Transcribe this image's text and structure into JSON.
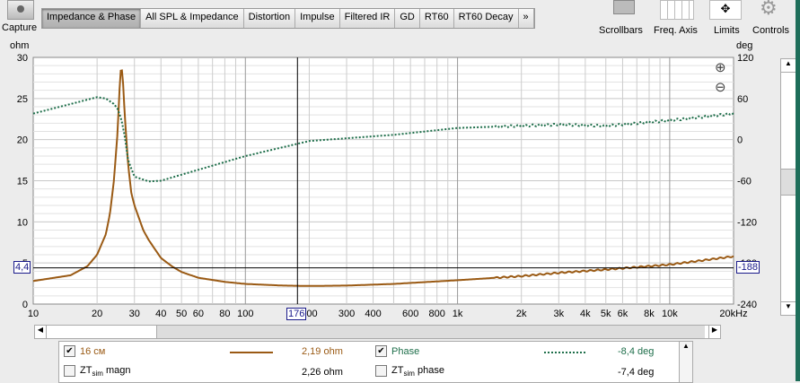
{
  "toolbar": {
    "capture": "Capture",
    "tabs": [
      "Impedance & Phase",
      "All SPL & Impedance",
      "Distortion",
      "Impulse",
      "Filtered IR",
      "GD",
      "RT60",
      "RT60 Decay",
      "»"
    ],
    "tools": [
      "Scrollbars",
      "Freq. Axis",
      "Limits",
      "Controls"
    ]
  },
  "cursor": {
    "freq": "176",
    "left_value": "4,4",
    "right_value": "-188"
  },
  "legend": {
    "rows": [
      {
        "name": "16 см",
        "checked": true,
        "value": "2,19 ohm",
        "phase_name": "Phase",
        "phase_checked": true,
        "phase_value": "-8,4 deg"
      },
      {
        "name": "ZT",
        "sub": "sim",
        "suffix": " magn",
        "checked": false,
        "value": "2,26 ohm",
        "phase_name": "ZT",
        "phase_sub": "sim",
        "phase_suffix": " phase",
        "phase_checked": false,
        "phase_value": "-7,4 deg"
      }
    ]
  },
  "chart_data": {
    "type": "line",
    "xscale": "log",
    "xlim": [
      10,
      20000
    ],
    "ylim": [
      0,
      30
    ],
    "y2lim": [
      -240,
      120
    ],
    "ylabel": "ohm",
    "y2label": "deg",
    "xunit": "kHz",
    "xticks": [
      "10",
      "20",
      "30",
      "40",
      "50",
      "60",
      "80",
      "100",
      "200",
      "300",
      "400",
      "600",
      "800",
      "1k",
      "2k",
      "3k",
      "4k",
      "5k",
      "6k",
      "8k",
      "10k",
      "20kHz"
    ],
    "xtick_values": [
      10,
      20,
      30,
      40,
      50,
      60,
      80,
      100,
      200,
      300,
      400,
      600,
      800,
      1000,
      2000,
      3000,
      4000,
      5000,
      6000,
      8000,
      10000,
      20000
    ],
    "yticks": [
      0,
      5,
      10,
      15,
      20,
      25,
      30
    ],
    "y2ticks": [
      -240,
      -180,
      -120,
      -60,
      0,
      60,
      120
    ],
    "grid": true,
    "series": [
      {
        "name": "16 см",
        "axis": "left",
        "color": "#9a5a14",
        "style": "solid",
        "x": [
          10,
          15,
          18,
          20,
          22,
          23,
          24,
          25,
          25.5,
          26,
          26.5,
          27,
          28,
          29,
          30,
          33,
          35,
          40,
          45,
          50,
          60,
          80,
          100,
          150,
          200,
          300,
          500,
          1000,
          2000,
          3000,
          5000,
          10000,
          20000
        ],
        "y": [
          2.8,
          3.5,
          4.6,
          6.0,
          8.5,
          11,
          15,
          21,
          26,
          29.3,
          27,
          23,
          17,
          13.5,
          12,
          9,
          7.8,
          5.6,
          4.6,
          3.9,
          3.2,
          2.7,
          2.45,
          2.25,
          2.2,
          2.25,
          2.45,
          2.9,
          3.4,
          3.8,
          4.2,
          4.8,
          5.8
        ]
      },
      {
        "name": "Phase",
        "axis": "right",
        "color": "#1e6e4a",
        "style": "dotted",
        "x": [
          10,
          15,
          20,
          22,
          24,
          25,
          26,
          27,
          28,
          30,
          35,
          40,
          60,
          100,
          200,
          500,
          1000,
          3000,
          5000,
          10000,
          20000
        ],
        "y": [
          38,
          52,
          62,
          60,
          52,
          45,
          30,
          5,
          -30,
          -54,
          -61,
          -60,
          -44,
          -24,
          -2,
          7,
          17,
          22,
          20,
          28,
          38
        ]
      }
    ]
  }
}
